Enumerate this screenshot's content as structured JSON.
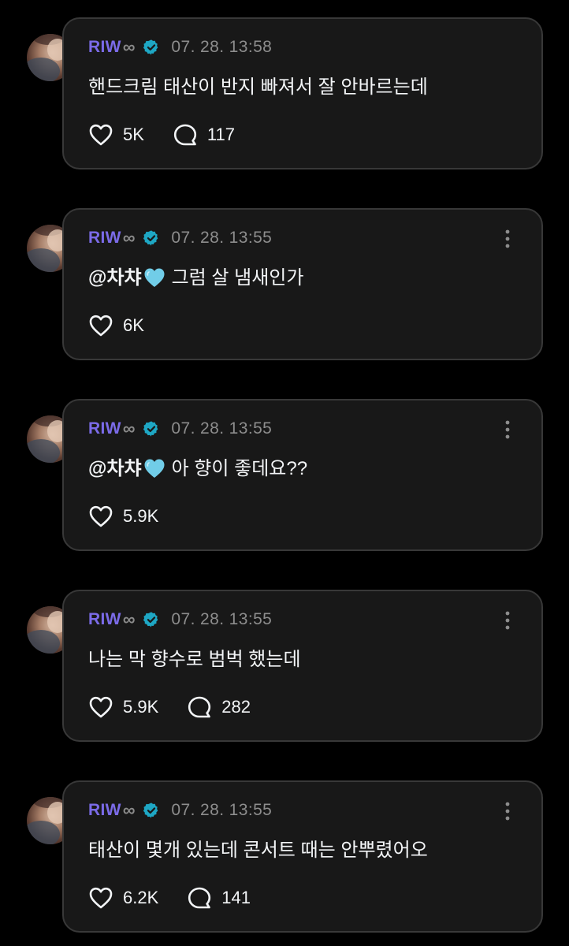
{
  "colors": {
    "background": "#000000",
    "card": "#181818",
    "card_border": "#383838",
    "username": "#7b6be8",
    "verified": "#1ea7c4",
    "timestamp": "#8d8d8d"
  },
  "posts": [
    {
      "username": "RIW",
      "suffix": "∞",
      "timestamp": "07. 28. 13:58",
      "mention": "",
      "text": "핸드크림 태산이 반지 빠져서 잘 안바르는데",
      "likes": "5K",
      "replies": "117",
      "show_more": false
    },
    {
      "username": "RIW",
      "suffix": "∞",
      "timestamp": "07. 28. 13:55",
      "mention": "@차챠",
      "text": "그럼 살 냄새인가",
      "likes": "6K",
      "replies": "",
      "show_more": true
    },
    {
      "username": "RIW",
      "suffix": "∞",
      "timestamp": "07. 28. 13:55",
      "mention": "@차챠",
      "text": "아 향이 좋데요??",
      "likes": "5.9K",
      "replies": "",
      "show_more": true
    },
    {
      "username": "RIW",
      "suffix": "∞",
      "timestamp": "07. 28. 13:55",
      "mention": "",
      "text": "나는 막 향수로 범벅 했는데",
      "likes": "5.9K",
      "replies": "282",
      "show_more": true
    },
    {
      "username": "RIW",
      "suffix": "∞",
      "timestamp": "07. 28. 13:55",
      "mention": "",
      "text": "태산이 몇개 있는데 콘서트 때는 안뿌렸어오",
      "likes": "6.2K",
      "replies": "141",
      "show_more": true
    }
  ]
}
